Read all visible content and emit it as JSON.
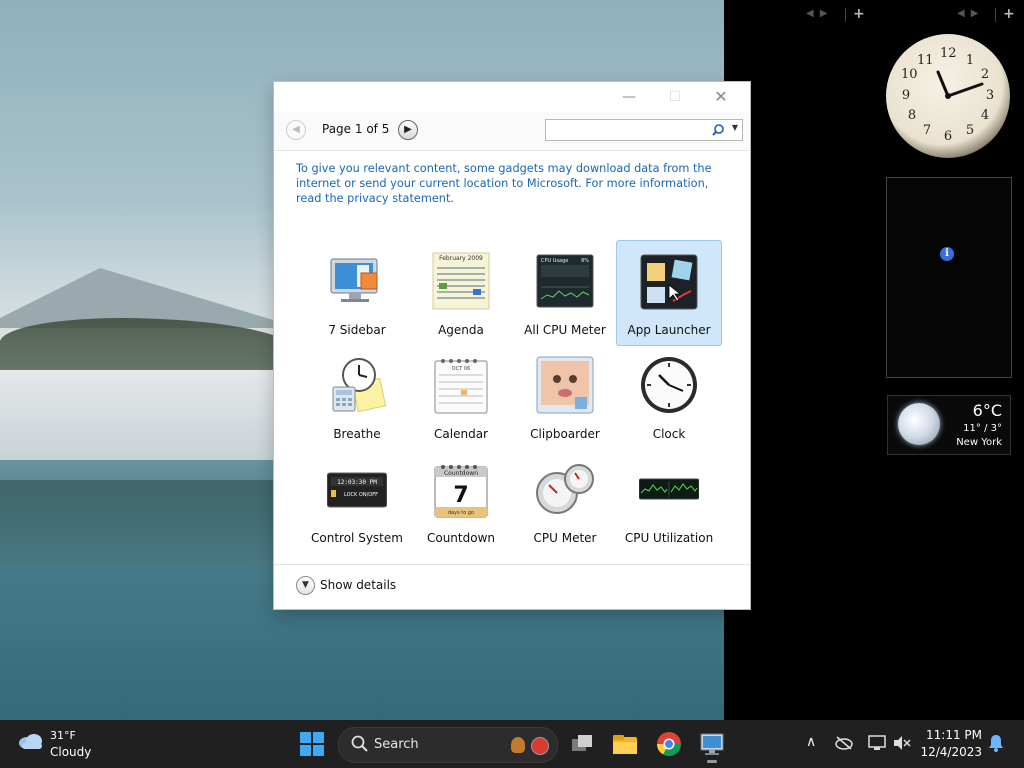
{
  "dialog": {
    "minimize_glyph": "—",
    "maximize_glyph": "☐",
    "close_glyph": "✕",
    "page_label": "Page 1 of 5",
    "search_value": "",
    "notice": "To give you relevant content, some gadgets may download data from the internet or send your current location to Microsoft. For more information, read the privacy statement.",
    "gadgets": [
      {
        "label": "7 Sidebar",
        "icon": "monitor-icon",
        "selected": false
      },
      {
        "label": "Agenda",
        "icon": "agenda-calendar-icon",
        "selected": false
      },
      {
        "label": "All CPU Meter",
        "icon": "cpu-usage-icon",
        "selected": false
      },
      {
        "label": "App Launcher",
        "icon": "app-launcher-icon",
        "selected": true
      },
      {
        "label": "Breathe",
        "icon": "breathe-icon",
        "selected": false
      },
      {
        "label": "Calendar",
        "icon": "calendar-icon",
        "selected": false
      },
      {
        "label": "Clipboarder",
        "icon": "clipboarder-icon",
        "selected": false
      },
      {
        "label": "Clock",
        "icon": "clock-icon",
        "selected": false
      },
      {
        "label": "Control System",
        "icon": "control-system-icon",
        "selected": false
      },
      {
        "label": "Countdown",
        "icon": "countdown-icon",
        "selected": false
      },
      {
        "label": "CPU Meter",
        "icon": "cpu-meter-icon",
        "selected": false
      },
      {
        "label": "CPU Utilization",
        "icon": "cpu-utilization-icon",
        "selected": false
      }
    ],
    "agenda_thumb_text": "February 2009",
    "calendar_thumb_text": "OCT 06",
    "control_thumb_time": "12:03:30 PM",
    "control_thumb_lock": "LOCK ON/OFF",
    "countdown_thumb_title": "Countdown",
    "countdown_thumb_number": "7",
    "countdown_thumb_sub": "days to go",
    "cpu_thumb_title": "CPU Usage",
    "cpu_thumb_pct": "8%",
    "show_details_label": "Show details"
  },
  "sidebar": {
    "clock_numbers": [
      "12",
      "1",
      "2",
      "3",
      "4",
      "5",
      "6",
      "7",
      "8",
      "9",
      "10",
      "11"
    ],
    "weather": {
      "temp": "6°C",
      "range": "11° / 3°",
      "city": "New York"
    }
  },
  "taskbar": {
    "weather_temp": "31°F",
    "weather_condition": "Cloudy",
    "search_placeholder": "Search",
    "time": "11:11 PM",
    "date": "12/4/2023",
    "colors": {
      "background": "#202020",
      "start_accent": "#3fa9f5",
      "bell": "#6cb6ff"
    }
  }
}
